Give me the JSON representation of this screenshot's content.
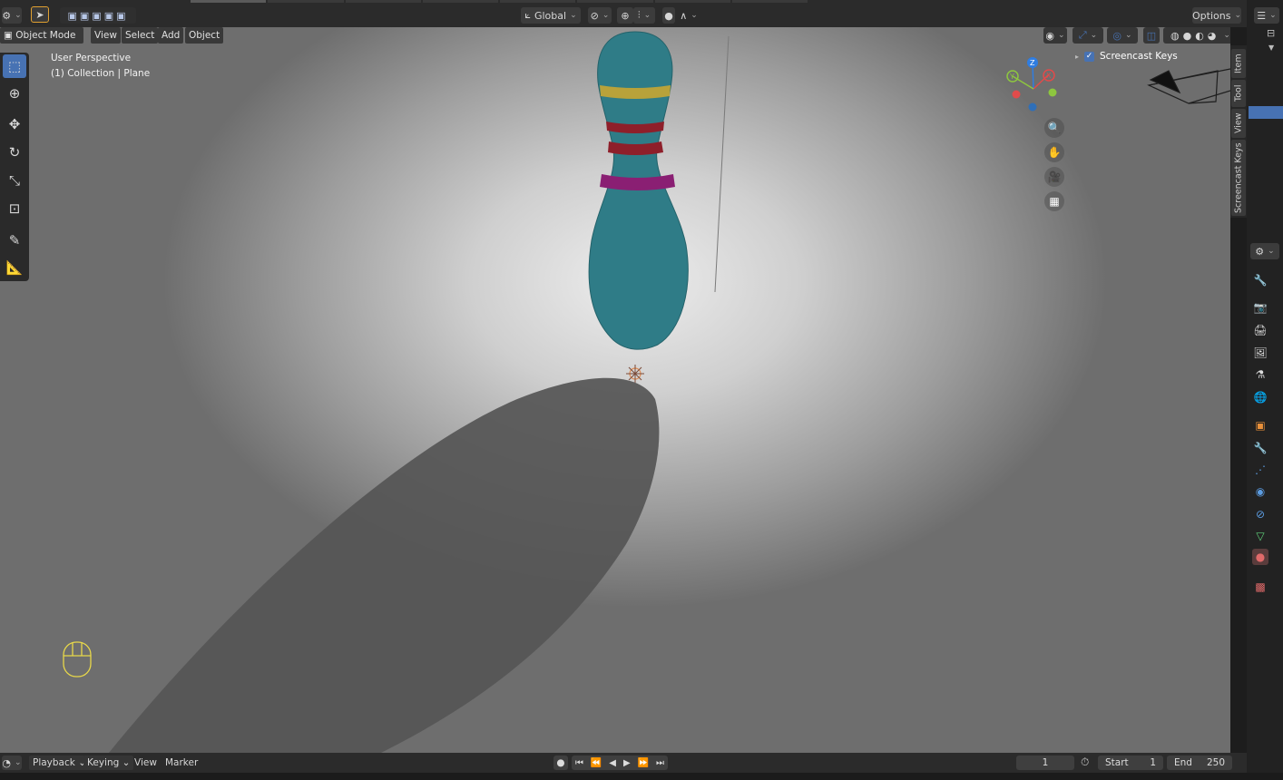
{
  "header": {
    "orientation": "Global",
    "options_label": "Options"
  },
  "menubar": {
    "mode": "Object Mode",
    "items": [
      "View",
      "Select",
      "Add",
      "Object"
    ]
  },
  "viewport": {
    "perspective": "User Perspective",
    "collection": "(1) Collection | Plane"
  },
  "gizmo": {
    "axes": [
      "X",
      "Y",
      "Z"
    ],
    "colors": {
      "x": "#e14b4b",
      "y": "#8dc63f",
      "z": "#2f7de1"
    }
  },
  "npanel": {
    "screencast_keys": "Screencast Keys",
    "checked": true,
    "tabs": [
      "Item",
      "Tool",
      "View",
      "Screencast Keys"
    ]
  },
  "timeline": {
    "menus": [
      "Playback",
      "Keying",
      "View",
      "Marker"
    ],
    "current_frame": "1",
    "start_label": "Start",
    "start_value": "1",
    "end_label": "End",
    "end_value": "250"
  },
  "colors": {
    "accent": "#4772b3",
    "pin_body": "#2f7c87",
    "stripe_yellow": "#b8a23a",
    "stripe_red": "#8e1f2a",
    "stripe_magenta": "#8a1f73"
  },
  "tools": [
    "select-box-icon",
    "cursor-icon",
    "move-icon",
    "rotate-icon",
    "scale-icon",
    "transform-icon",
    "annotate-icon",
    "measure-icon"
  ],
  "properties_icons": [
    "tool-icon",
    "render-icon",
    "output-icon",
    "view-layer-icon",
    "scene-icon",
    "world-icon",
    "object-icon",
    "modifier-icon",
    "particles-icon",
    "physics-icon",
    "constraints-icon",
    "data-icon",
    "material-icon",
    "texture-icon"
  ]
}
